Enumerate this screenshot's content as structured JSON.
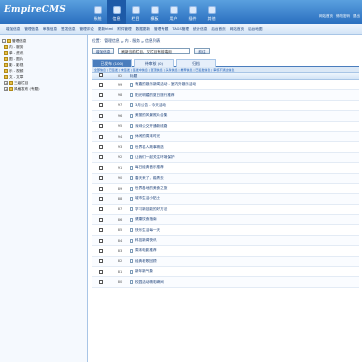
{
  "app": {
    "logo": "EmpireCMS"
  },
  "menu": [
    {
      "label": "系统"
    },
    {
      "label": "信息"
    },
    {
      "label": "栏目"
    },
    {
      "label": "模板"
    },
    {
      "label": "用户"
    },
    {
      "label": "插件"
    },
    {
      "label": "其他"
    }
  ],
  "quick": [
    "网站首页",
    "修改密码",
    "退出"
  ],
  "subnav": [
    "增加信息",
    "管理信息",
    "审核信息",
    "签发信息",
    "管理评论",
    "更新html",
    "附件管理",
    "数据更新",
    "管理专题",
    "TAGS管理",
    "统计信息",
    "后台首页",
    "网站首页",
    "后台地图"
  ],
  "sidebar": {
    "items": [
      {
        "label": "管理信息",
        "level": 0
      },
      {
        "label": "内 - 服务",
        "level": 1
      },
      {
        "label": "单 - 资讯",
        "level": 1
      },
      {
        "label": "图 - 图片",
        "level": 1
      },
      {
        "label": "影 - 影视",
        "level": 1
      },
      {
        "label": "乐 - 视频",
        "level": 1
      },
      {
        "label": "文 - 文章",
        "level": 1
      },
      {
        "label": "三级栏目",
        "level": 1
      },
      {
        "label": "风格发布 (专题)",
        "level": 1
      }
    ]
  },
  "crumb": {
    "prefix": "位置：",
    "items": [
      "管理信息",
      "内 - 服务",
      "信息列表"
    ]
  },
  "toolbar": {
    "add_label": "增加信息",
    "select_value": "刷新当前栏目，又栏目有前端用",
    "go_label": "前往"
  },
  "tabs": [
    {
      "label": "已发布 (100)"
    },
    {
      "label": "待审核 (0)"
    },
    {
      "label": "归档"
    }
  ],
  "filter": "全部信息 | 已签发 | 未签发 | 签发中信息 | 置顶信息 | 头条信息 | 推荐信息 | 已签发信息 | 审核不通过信息",
  "table": {
    "headers": [
      "",
      "ID",
      "标题"
    ],
    "rows": [
      {
        "id": "99",
        "title": "有趣的娱乐新闻活动 - 室内外娱乐活动"
      },
      {
        "id": "98",
        "title": "阳光明媚的夏日旅行推荐"
      },
      {
        "id": "97",
        "title": "3月公告 - 今天活动"
      },
      {
        "id": "96",
        "title": "美丽的风景照片合集"
      },
      {
        "id": "95",
        "title": "深圳公交开通新线路"
      },
      {
        "id": "94",
        "title": "休闲的周末时光"
      },
      {
        "id": "93",
        "title": "世界名人故事精选"
      },
      {
        "id": "92",
        "title": "让我们一起关注环境保护"
      },
      {
        "id": "91",
        "title": "每日经典音乐推荐"
      },
      {
        "id": "90",
        "title": "春天来了，踏青去"
      },
      {
        "id": "89",
        "title": "世界各地的美食之旅"
      },
      {
        "id": "88",
        "title": "城市生活小贴士"
      },
      {
        "id": "87",
        "title": "学习新技能的好方法"
      },
      {
        "id": "86",
        "title": "健康饮食指南"
      },
      {
        "id": "85",
        "title": "快乐生活每一天"
      },
      {
        "id": "84",
        "title": "科技新闻快讯"
      },
      {
        "id": "83",
        "title": "周末电影推荐"
      },
      {
        "id": "82",
        "title": "经典老歌回顾"
      },
      {
        "id": "81",
        "title": "新年新气象"
      },
      {
        "id": "80",
        "title": "校园活动精彩瞬间"
      }
    ]
  }
}
